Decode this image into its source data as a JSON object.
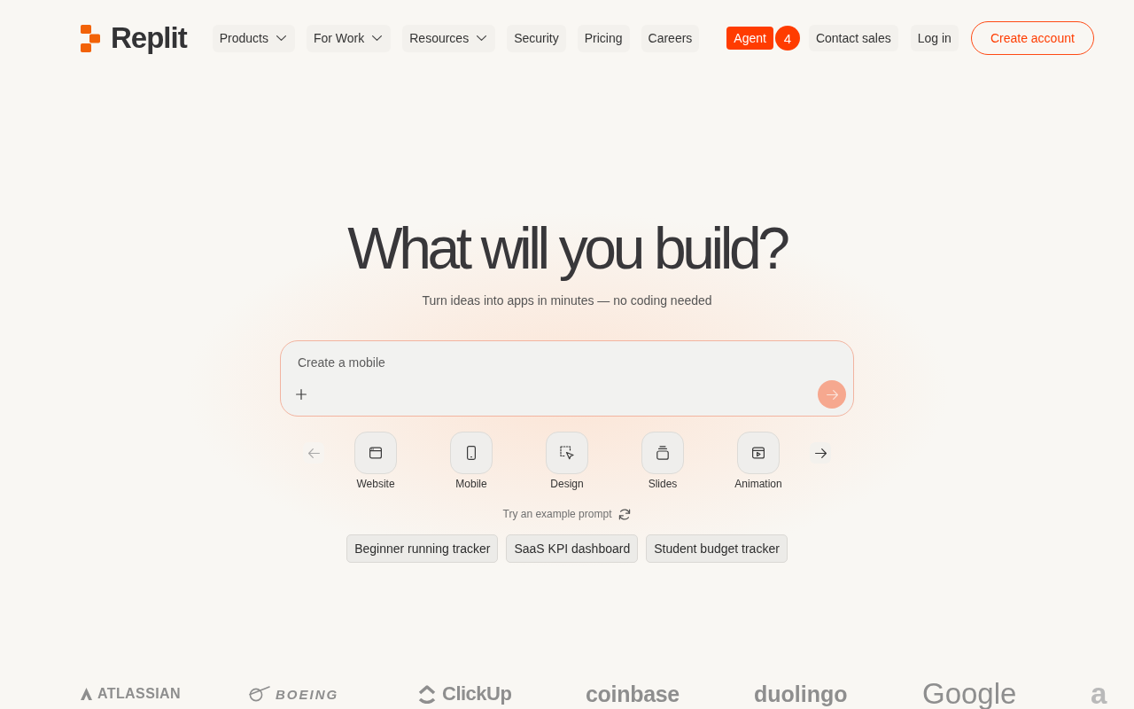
{
  "nav": {
    "brand": {
      "text": "Replit"
    },
    "items": [
      {
        "label": "Products",
        "dropdown": true
      },
      {
        "label": "For Work",
        "dropdown": true
      },
      {
        "label": "Resources",
        "dropdown": true
      },
      {
        "label": "Security",
        "dropdown": false
      },
      {
        "label": "Pricing",
        "dropdown": false
      },
      {
        "label": "Careers",
        "dropdown": false
      }
    ],
    "agent": {
      "label": "Agent",
      "badge": "4"
    },
    "actions": [
      {
        "label": "Contact sales",
        "kind": "ghost"
      },
      {
        "label": "Log in",
        "kind": "ghost"
      },
      {
        "label": "Create account",
        "kind": "outline"
      }
    ]
  },
  "hero": {
    "title": "What will you build?",
    "subtitle": "Turn ideas into apps in minutes — no coding needed"
  },
  "prompt": {
    "placeholder": "Create a mobile",
    "send_button": {
      "disabled": true
    }
  },
  "categories": {
    "prev": {
      "disabled": true
    },
    "next": {
      "disabled": false
    },
    "items": [
      {
        "label": "Website"
      },
      {
        "label": "Mobile"
      },
      {
        "label": "Design"
      },
      {
        "label": "Slides"
      },
      {
        "label": "Animation"
      }
    ]
  },
  "examples": {
    "label": "Try an example prompt",
    "items": [
      "Beginner running tracker",
      "SaaS KPI dashboard",
      "Student budget tracker"
    ]
  },
  "logos": [
    "ATLASSIAN",
    "BOEING",
    "ClickUp",
    "coinbase",
    "duolingo",
    "Google",
    "a"
  ]
}
